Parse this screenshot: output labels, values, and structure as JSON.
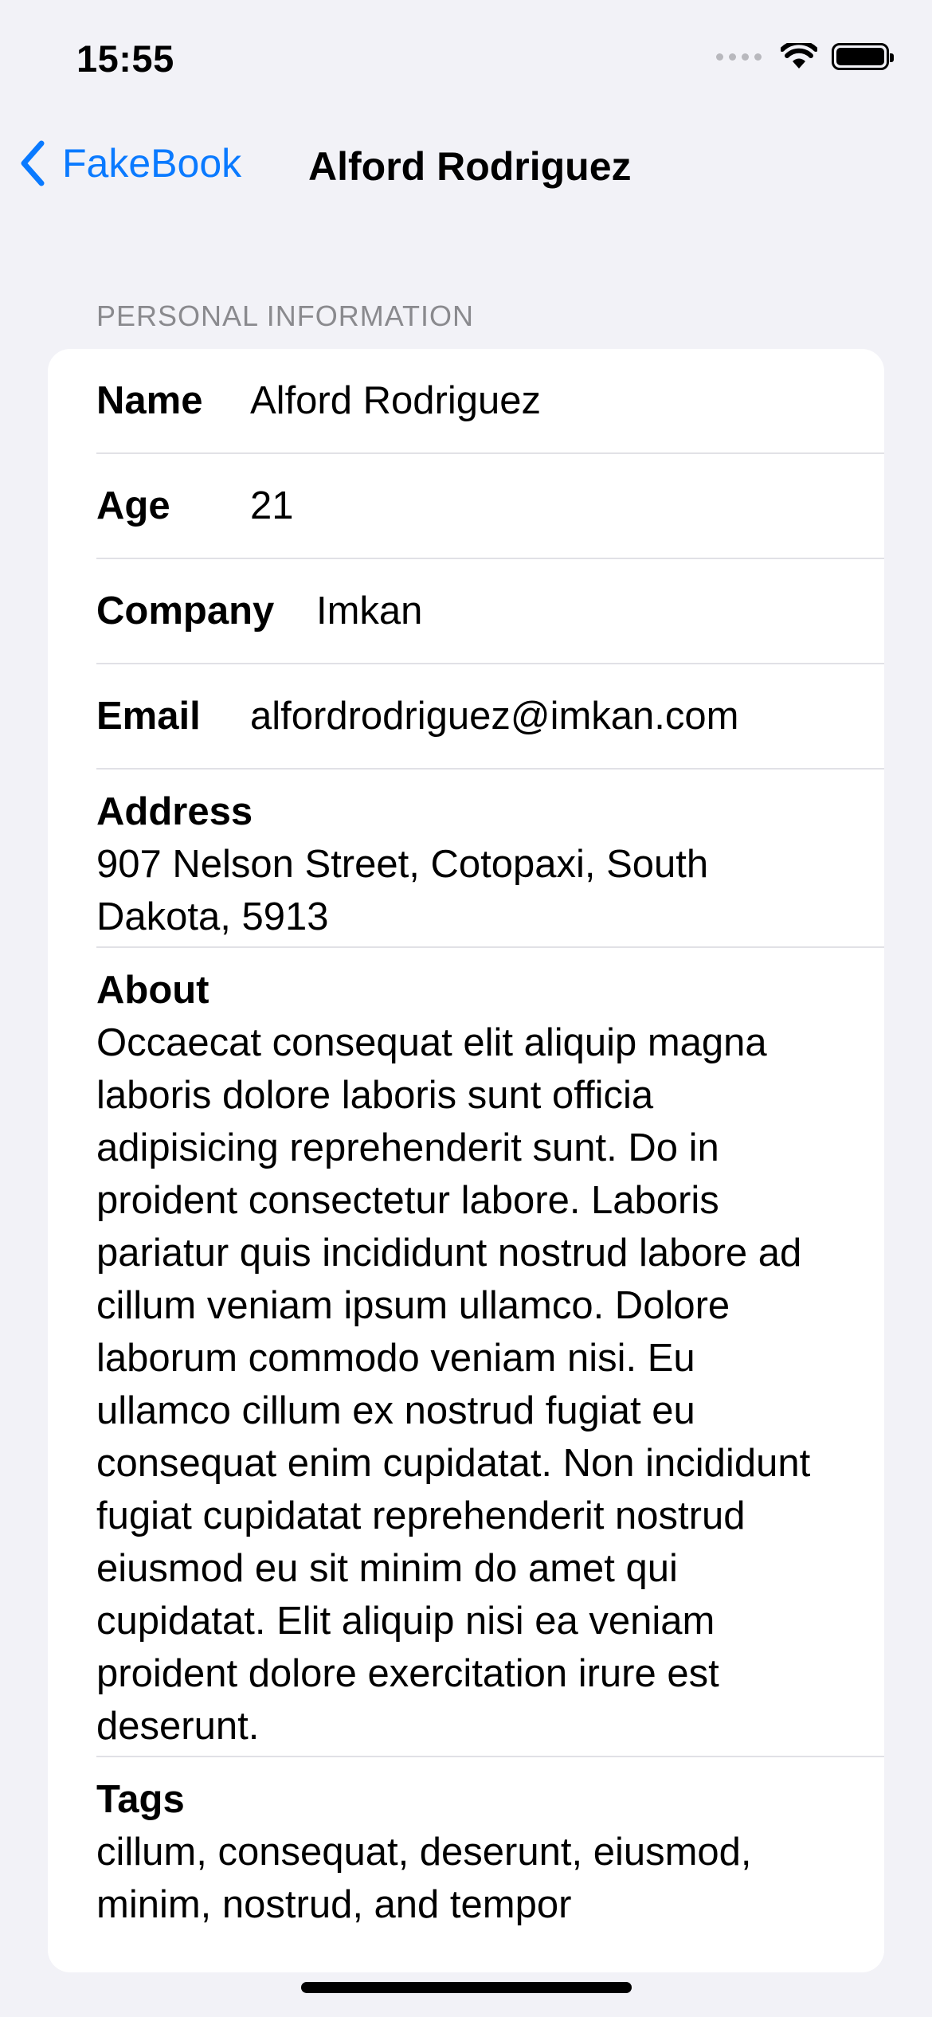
{
  "status_bar": {
    "time": "15:55"
  },
  "nav": {
    "back_label": "FakeBook",
    "title": "Alford Rodriguez"
  },
  "section": {
    "header": "PERSONAL INFORMATION",
    "rows": {
      "name": {
        "label": "Name",
        "value": "Alford Rodriguez"
      },
      "age": {
        "label": "Age",
        "value": "21"
      },
      "company": {
        "label": "Company",
        "value": "Imkan"
      },
      "email": {
        "label": "Email",
        "value": "alfordrodriguez@imkan.com"
      },
      "address": {
        "label": "Address",
        "value": "907 Nelson Street, Cotopaxi, South Dakota, 5913"
      },
      "about": {
        "label": "About",
        "value": "Occaecat consequat elit aliquip magna laboris dolore laboris sunt officia adipisicing reprehenderit sunt. Do in proident consectetur labore. Laboris pariatur quis incididunt nostrud labore ad cillum veniam ipsum ullamco. Dolore laborum commodo veniam nisi. Eu ullamco cillum ex nostrud fugiat eu consequat enim cupidatat. Non incididunt fugiat cupidatat reprehenderit nostrud eiusmod eu sit minim do amet qui cupidatat. Elit aliquip nisi ea veniam proident dolore exercitation irure est deserunt."
      },
      "tags": {
        "label": "Tags",
        "value": "cillum, consequat, deserunt, eiusmod, minim, nostrud, and tempor"
      }
    }
  },
  "colors": {
    "background": "#f2f2f7",
    "accent": "#0a7aff",
    "card": "#ffffff",
    "separator": "#e1e1e6",
    "secondary_text": "#8a8a8e"
  },
  "icons": [
    "chevron-left-icon",
    "cellular-signal-icon",
    "wifi-icon",
    "battery-icon"
  ]
}
